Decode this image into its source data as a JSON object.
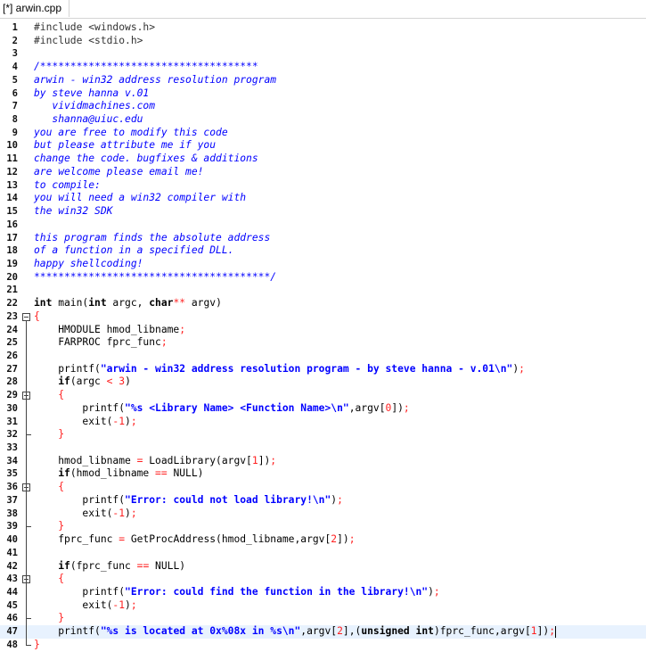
{
  "tab": {
    "title": "[*] arwin.cpp"
  },
  "editor": {
    "lines": [
      [
        [
          "pp",
          "#include <windows.h>"
        ]
      ],
      [
        [
          "pp",
          "#include <stdio.h>"
        ]
      ],
      [],
      [
        [
          "cm",
          "/************************************"
        ]
      ],
      [
        [
          "cm",
          "arwin - win32 address resolution program"
        ]
      ],
      [
        [
          "cm",
          "by steve hanna v.01"
        ]
      ],
      [
        [
          "cm",
          "   vividmachines.com"
        ]
      ],
      [
        [
          "cm",
          "   shanna@uiuc.edu"
        ]
      ],
      [
        [
          "cm",
          "you are free to modify this code"
        ]
      ],
      [
        [
          "cm",
          "but please attribute me if you"
        ]
      ],
      [
        [
          "cm",
          "change the code. bugfixes & additions"
        ]
      ],
      [
        [
          "cm",
          "are welcome please email me!"
        ]
      ],
      [
        [
          "cm",
          "to compile:"
        ]
      ],
      [
        [
          "cm",
          "you will need a win32 compiler with"
        ]
      ],
      [
        [
          "cm",
          "the win32 SDK"
        ]
      ],
      [],
      [
        [
          "cm",
          "this program finds the absolute address"
        ]
      ],
      [
        [
          "cm",
          "of a function in a specified DLL."
        ]
      ],
      [
        [
          "cm",
          "happy shellcoding!"
        ]
      ],
      [
        [
          "cm",
          "***************************************/"
        ]
      ],
      [],
      [
        [
          "kw",
          "int"
        ],
        [
          "id",
          " main("
        ],
        [
          "kw",
          "int"
        ],
        [
          "id",
          " argc, "
        ],
        [
          "kw",
          "char"
        ],
        [
          "op",
          "**"
        ],
        [
          "id",
          " argv)"
        ]
      ],
      [
        [
          "op",
          "{"
        ]
      ],
      [
        [
          "id",
          "    HMODULE hmod_libname"
        ],
        [
          "op",
          ";"
        ]
      ],
      [
        [
          "id",
          "    FARPROC fprc_func"
        ],
        [
          "op",
          ";"
        ]
      ],
      [],
      [
        [
          "id",
          "    printf("
        ],
        [
          "st",
          "\"arwin - win32 address resolution program - by steve hanna - v.01\\n\""
        ],
        [
          "id",
          ")"
        ],
        [
          "op",
          ";"
        ]
      ],
      [
        [
          "kw",
          "    if"
        ],
        [
          "id",
          "(argc "
        ],
        [
          "op",
          "<"
        ],
        [
          "id",
          " "
        ],
        [
          "num",
          "3"
        ],
        [
          "id",
          ")"
        ]
      ],
      [
        [
          "op",
          "    {"
        ]
      ],
      [
        [
          "id",
          "        printf("
        ],
        [
          "st",
          "\"%s <Library Name> <Function Name>\\n\""
        ],
        [
          "id",
          ",argv["
        ],
        [
          "num",
          "0"
        ],
        [
          "id",
          "])"
        ],
        [
          "op",
          ";"
        ]
      ],
      [
        [
          "id",
          "        exit("
        ],
        [
          "op",
          "-"
        ],
        [
          "num",
          "1"
        ],
        [
          "id",
          ")"
        ],
        [
          "op",
          ";"
        ]
      ],
      [
        [
          "op",
          "    }"
        ]
      ],
      [],
      [
        [
          "id",
          "    hmod_libname "
        ],
        [
          "op",
          "="
        ],
        [
          "id",
          " LoadLibrary(argv["
        ],
        [
          "num",
          "1"
        ],
        [
          "id",
          "])"
        ],
        [
          "op",
          ";"
        ]
      ],
      [
        [
          "kw",
          "    if"
        ],
        [
          "id",
          "(hmod_libname "
        ],
        [
          "op",
          "=="
        ],
        [
          "id",
          " NULL)"
        ]
      ],
      [
        [
          "op",
          "    {"
        ]
      ],
      [
        [
          "id",
          "        printf("
        ],
        [
          "st",
          "\"Error: could not load library!\\n\""
        ],
        [
          "id",
          ")"
        ],
        [
          "op",
          ";"
        ]
      ],
      [
        [
          "id",
          "        exit("
        ],
        [
          "op",
          "-"
        ],
        [
          "num",
          "1"
        ],
        [
          "id",
          ")"
        ],
        [
          "op",
          ";"
        ]
      ],
      [
        [
          "op",
          "    }"
        ]
      ],
      [
        [
          "id",
          "    fprc_func "
        ],
        [
          "op",
          "="
        ],
        [
          "id",
          " GetProcAddress(hmod_libname,argv["
        ],
        [
          "num",
          "2"
        ],
        [
          "id",
          "])"
        ],
        [
          "op",
          ";"
        ]
      ],
      [],
      [
        [
          "kw",
          "    if"
        ],
        [
          "id",
          "(fprc_func "
        ],
        [
          "op",
          "=="
        ],
        [
          "id",
          " NULL)"
        ]
      ],
      [
        [
          "op",
          "    {"
        ]
      ],
      [
        [
          "id",
          "        printf("
        ],
        [
          "st",
          "\"Error: could find the function in the library!\\n\""
        ],
        [
          "id",
          ")"
        ],
        [
          "op",
          ";"
        ]
      ],
      [
        [
          "id",
          "        exit("
        ],
        [
          "op",
          "-"
        ],
        [
          "num",
          "1"
        ],
        [
          "id",
          ")"
        ],
        [
          "op",
          ";"
        ]
      ],
      [
        [
          "op",
          "    }"
        ]
      ],
      [
        [
          "id",
          "    printf("
        ],
        [
          "st",
          "\"%s is located at 0x%08x in %s\\n\""
        ],
        [
          "id",
          ",argv["
        ],
        [
          "num",
          "2"
        ],
        [
          "id",
          "],("
        ],
        [
          "kw",
          "unsigned int"
        ],
        [
          "id",
          ")fprc_func,argv["
        ],
        [
          "num",
          "1"
        ],
        [
          "id",
          "])"
        ],
        [
          "op",
          ";"
        ]
      ],
      [
        [
          "op",
          "}"
        ]
      ]
    ],
    "current_line": 47,
    "fold_openers": [
      23,
      29,
      36,
      43
    ]
  }
}
